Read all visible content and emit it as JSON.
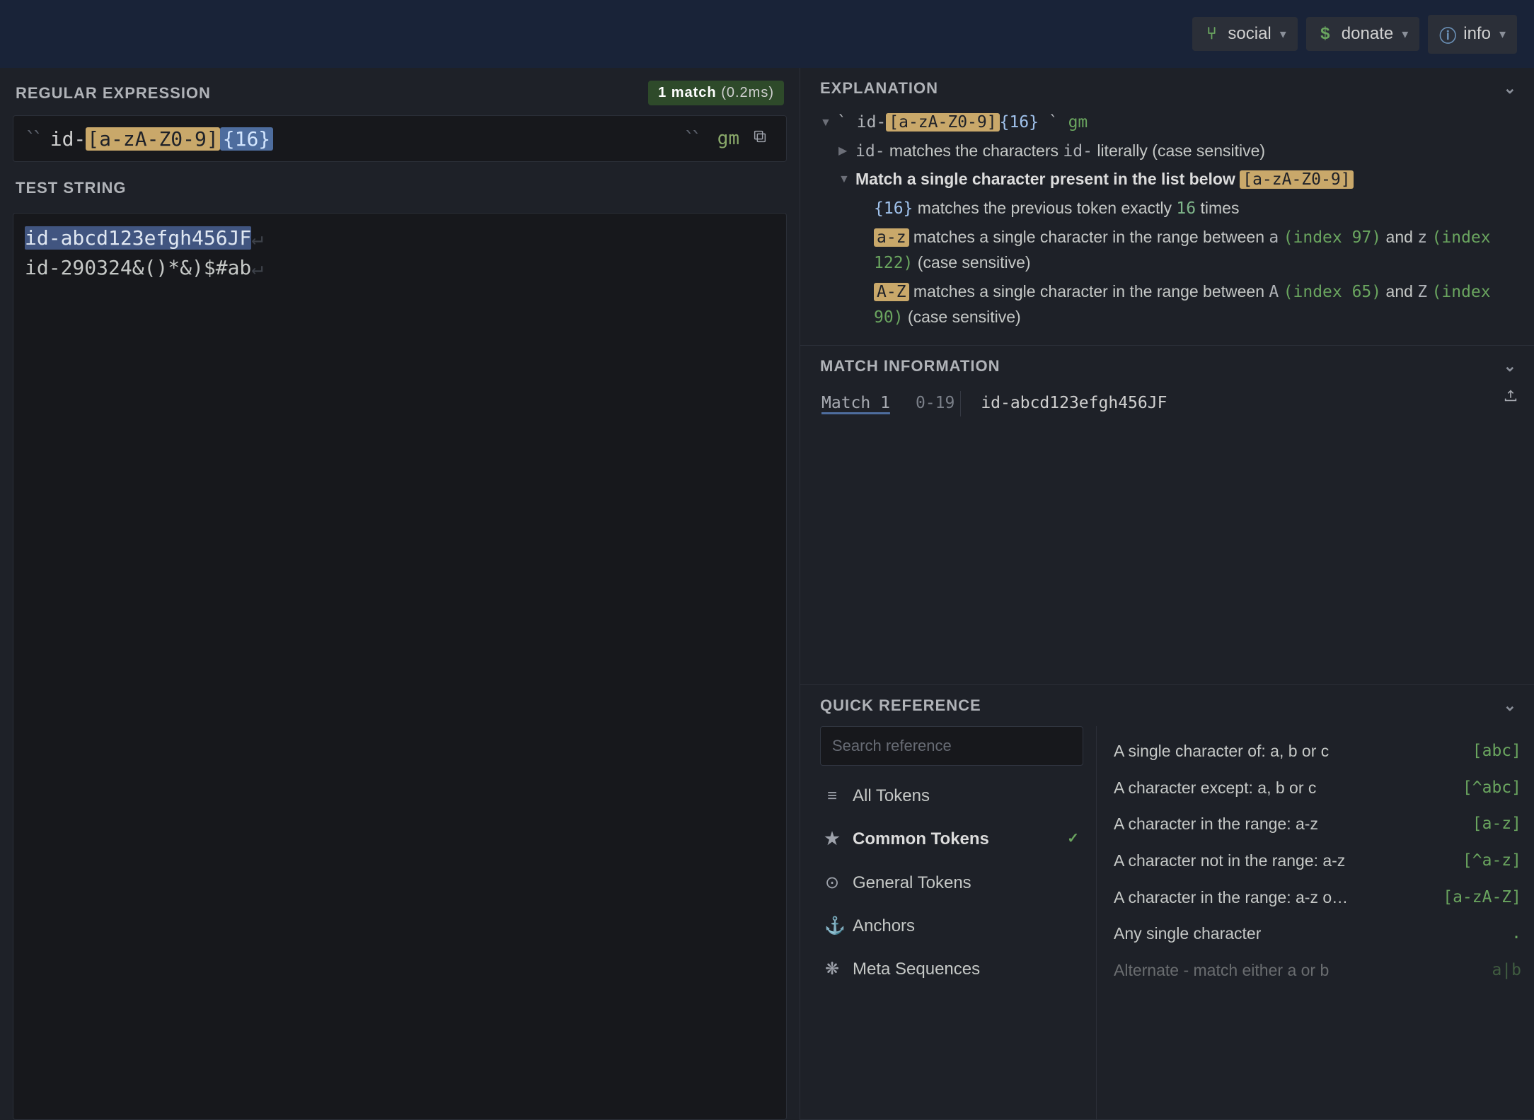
{
  "topbar": {
    "social": "social",
    "donate": "donate",
    "info": "info"
  },
  "regex_section": {
    "title": "REGULAR EXPRESSION",
    "match_count_prefix": "1 match",
    "match_time": " (0.2ms)",
    "pattern_literal": "id-",
    "pattern_class": "[a-zA-Z0-9]",
    "pattern_quant": "{16}",
    "flags": "gm"
  },
  "test_section": {
    "title": "TEST STRING",
    "line1": "id-abcd123efgh456JF",
    "line2": "id-290324&()*&)$#ab"
  },
  "explanation": {
    "title": "EXPLANATION",
    "delim_open": "`",
    "pattern_literal": "id-",
    "pattern_class": "[a-zA-Z0-9]",
    "pattern_quant": "{16}",
    "delim_close": "`",
    "flags": "gm",
    "line_id_a": "id-",
    "line_id_b": " matches the characters ",
    "line_id_c": "id-",
    "line_id_d": " literally (case sensitive)",
    "line_match_bold": "Match a single character present in the list below ",
    "line_match_class": "[a-zA-Z0-9]",
    "line_16_a": "{16}",
    "line_16_b": " matches the previous token exactly ",
    "line_16_c": "16",
    "line_16_d": " times",
    "line_az_a": "a-z",
    "line_az_b": " matches a single character in the range between ",
    "line_az_c": "a",
    "line_az_idx1": "(index 97)",
    "line_az_and": " and ",
    "line_az_d": "z",
    "line_az_idx2": "(index 122)",
    "line_az_cs": " (case sensitive)",
    "line_AZ_a": "A-Z",
    "line_AZ_b": " matches a single character in the range between ",
    "line_AZ_c": "A",
    "line_AZ_idx1": "(index 65)",
    "line_AZ_and": " and ",
    "line_AZ_d": "Z",
    "line_AZ_idx2": "(index 90)",
    "line_AZ_cs": " (case sensitive)"
  },
  "matchinfo": {
    "title": "MATCH INFORMATION",
    "name": "Match 1",
    "range": "0-19",
    "text": "id-abcd123efgh456JF"
  },
  "quickref": {
    "title": "QUICK REFERENCE",
    "search_placeholder": "Search reference",
    "categories": [
      {
        "icon": "≡",
        "label": "All Tokens"
      },
      {
        "icon": "★",
        "label": "Common Tokens",
        "active": true
      },
      {
        "icon": "⊙",
        "label": "General Tokens"
      },
      {
        "icon": "⚓",
        "label": "Anchors"
      },
      {
        "icon": "❋",
        "label": "Meta Sequences"
      }
    ],
    "items": [
      {
        "desc": "A single character of: a, b or c",
        "pat": "[abc]"
      },
      {
        "desc": "A character except: a, b or c",
        "pat": "[^abc]"
      },
      {
        "desc": "A character in the range: a-z",
        "pat": "[a-z]"
      },
      {
        "desc": "A character not in the range: a-z",
        "pat": "[^a-z]"
      },
      {
        "desc": "A character in the range: a-z o…",
        "pat": "[a-zA-Z]"
      },
      {
        "desc": "Any single character",
        "pat": "."
      },
      {
        "desc": "Alternate - match either a or b",
        "pat": "a|b",
        "fade": true
      }
    ]
  }
}
